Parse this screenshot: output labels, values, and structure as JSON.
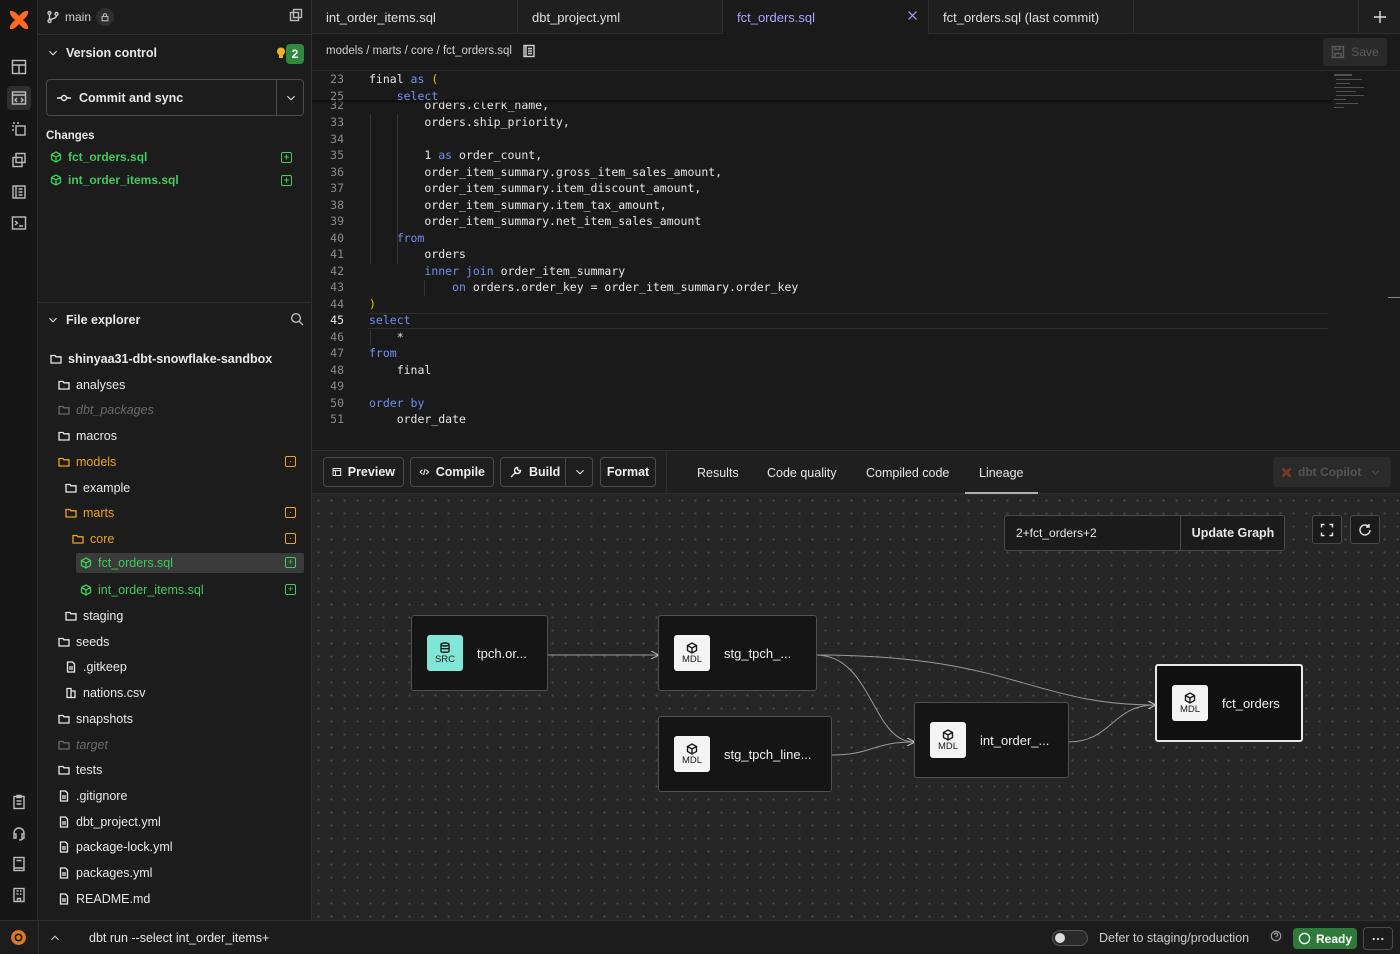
{
  "rail": {
    "icons": [
      "layout-icon",
      "code-editor-icon",
      "dashed-select-icon",
      "copy-icon",
      "notebook-icon",
      "terminal-icon",
      "clipboard-icon",
      "headset-icon",
      "book-icon",
      "building-icon",
      "gear-icon"
    ]
  },
  "sidebar": {
    "branch": "main",
    "version_control_title": "Version control",
    "notification_count": "2",
    "commit_label": "Commit and sync",
    "changes_title": "Changes",
    "changes": [
      {
        "name": "fct_orders.sql"
      },
      {
        "name": "int_order_items.sql"
      }
    ],
    "file_explorer_title": "File explorer",
    "tree": [
      {
        "name": "shinyaa31-dbt-snowflake-sandbox",
        "type": "folder"
      },
      {
        "name": "analyses",
        "type": "folder"
      },
      {
        "name": "dbt_packages",
        "type": "folder-dim"
      },
      {
        "name": "macros",
        "type": "folder"
      },
      {
        "name": "models",
        "type": "folder-mod"
      },
      {
        "name": "example",
        "type": "folder"
      },
      {
        "name": "marts",
        "type": "folder-mod"
      },
      {
        "name": "core",
        "type": "folder-mod"
      },
      {
        "name": "fct_orders.sql",
        "type": "model-new"
      },
      {
        "name": "int_order_items.sql",
        "type": "model-new"
      },
      {
        "name": "staging",
        "type": "folder"
      },
      {
        "name": "seeds",
        "type": "folder"
      },
      {
        "name": ".gitkeep",
        "type": "file"
      },
      {
        "name": "nations.csv",
        "type": "csv"
      },
      {
        "name": "snapshots",
        "type": "folder"
      },
      {
        "name": "target",
        "type": "folder-dim"
      },
      {
        "name": "tests",
        "type": "folder"
      },
      {
        "name": ".gitignore",
        "type": "file"
      },
      {
        "name": "dbt_project.yml",
        "type": "file"
      },
      {
        "name": "package-lock.yml",
        "type": "file"
      },
      {
        "name": "packages.yml",
        "type": "file"
      },
      {
        "name": "README.md",
        "type": "file"
      }
    ]
  },
  "tabs": [
    {
      "label": "int_order_items.sql"
    },
    {
      "label": "dbt_project.yml"
    },
    {
      "label": "fct_orders.sql"
    },
    {
      "label": "fct_orders.sql (last commit)"
    }
  ],
  "breadcrumb": "models / marts / core / fct_orders.sql",
  "save_label": "Save",
  "code": [
    {
      "n": "23",
      "html": "final <span class='kw'>as</span> <span style='color:#e6c300'>(</span>"
    },
    {
      "n": "25",
      "html": "    <span class='kw'>select</span>"
    },
    {
      "n": "32",
      "html": "        orders.clerk_name,"
    },
    {
      "n": "33",
      "html": "        orders.ship_priority,"
    },
    {
      "n": "34",
      "html": ""
    },
    {
      "n": "35",
      "html": "        1 <span class='kw'>as</span> order_count,"
    },
    {
      "n": "36",
      "html": "        order_item_summary.gross_item_sales_amount,"
    },
    {
      "n": "37",
      "html": "        order_item_summary.item_discount_amount,"
    },
    {
      "n": "38",
      "html": "        order_item_summary.item_tax_amount,"
    },
    {
      "n": "39",
      "html": "        order_item_summary.net_item_sales_amount"
    },
    {
      "n": "40",
      "html": "    <span class='kw'>from</span>"
    },
    {
      "n": "41",
      "html": "        orders"
    },
    {
      "n": "42",
      "html": "        <span class='kw'>inner join</span> order_item_summary"
    },
    {
      "n": "43",
      "html": "            <span class='kw'>on</span> orders.order_key = order_item_summary.order_key"
    },
    {
      "n": "44",
      "html": "<span style='color:#e6c300'>)</span>"
    },
    {
      "n": "45",
      "html": "<span class='kw'>select</span>"
    },
    {
      "n": "46",
      "html": "    *"
    },
    {
      "n": "47",
      "html": "<span class='kw'>from</span>"
    },
    {
      "n": "48",
      "html": "    final"
    },
    {
      "n": "49",
      "html": ""
    },
    {
      "n": "50",
      "html": "<span class='kw'>order by</span>"
    },
    {
      "n": "51",
      "html": "    order_date"
    }
  ],
  "toolbar": {
    "preview": "Preview",
    "compile": "Compile",
    "build": "Build",
    "format": "Format",
    "results": "Results",
    "code_quality": "Code quality",
    "compiled_code": "Compiled code",
    "lineage": "Lineage",
    "copilot": "dbt Copilot"
  },
  "lineage": {
    "selector_value": "2+fct_orders+2",
    "update_label": "Update Graph",
    "nodes": [
      {
        "label": "tpch.or...",
        "kind": "SRC"
      },
      {
        "label": "stg_tpch_...",
        "kind": "MDL"
      },
      {
        "label": "stg_tpch_line...",
        "kind": "MDL"
      },
      {
        "label": "int_order_...",
        "kind": "MDL"
      },
      {
        "label": "fct_orders",
        "kind": "MDL"
      }
    ]
  },
  "status": {
    "command": "dbt run --select int_order_items+",
    "defer_label": "Defer to staging/production",
    "ready_label": "Ready"
  },
  "colors": {
    "accent": "#a8a2ff",
    "added": "#3fca5c",
    "modified": "#f0a020",
    "ready": "#2d7a3a"
  }
}
